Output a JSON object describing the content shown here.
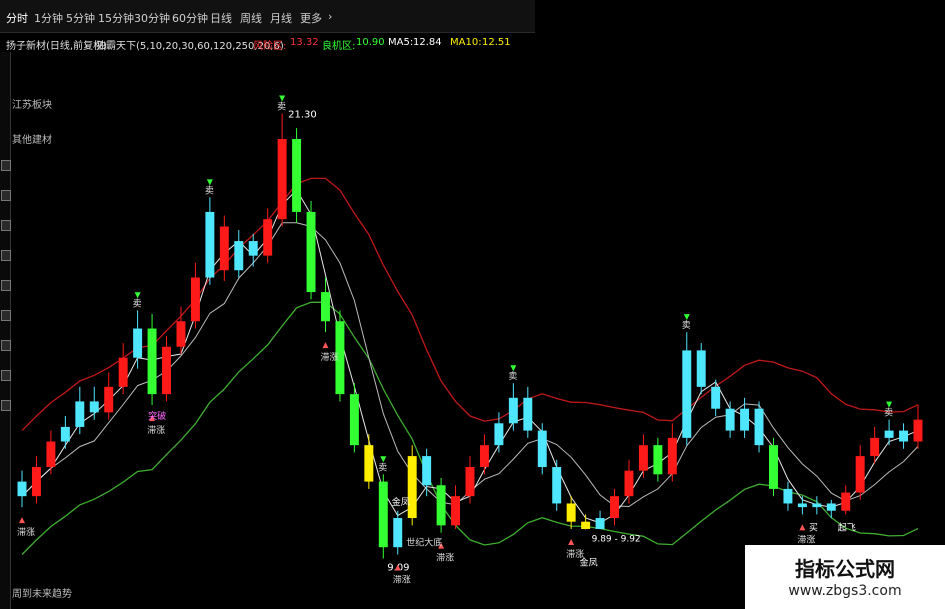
{
  "toolbar": {
    "items": [
      "分时",
      "1分钟",
      "5分钟",
      "15分钟",
      "30分钟",
      "60分钟",
      "日线",
      "周线",
      "月线",
      "更多"
    ]
  },
  "info": {
    "stock": "扬子新材(日线,前复权)",
    "indicator": "独霸天下(5,10,20,30,60,120,250,20,6)",
    "risk_label": "风险区:",
    "risk_value": "13.32",
    "opp_label": "良机区:",
    "opp_value": "10.90",
    "ma5_label": "MA5:",
    "ma5_value": "12.84",
    "ma10_label": "MA10:",
    "ma10_value": "12.51"
  },
  "side_labels": [
    "江苏板块",
    "其他建材"
  ],
  "bottom_text": "周到未来趋势",
  "colors": {
    "up": "#ff1a1a",
    "down": "#33ff33",
    "cyan": "#4fe6ff",
    "yellow": "#ffee00",
    "upper_band": "#c01818",
    "lower_band": "#3fae30",
    "ma": "#e8e8e8"
  },
  "chart_data": {
    "type": "candlestick",
    "annotations": {
      "high": "21.30",
      "low": "9.09",
      "range": "9.89 - 9.92",
      "sell": "卖",
      "buy": "买",
      "fly": "起飞",
      "gold": "金凤",
      "century": "世纪大底",
      "break": "突破",
      "tail": "滞涨"
    },
    "candles": [
      {
        "o": 11.2,
        "c": 10.8,
        "h": 11.5,
        "l": 10.5,
        "color": "cyan"
      },
      {
        "o": 10.8,
        "c": 11.6,
        "h": 11.9,
        "l": 10.6,
        "color": "up"
      },
      {
        "o": 11.6,
        "c": 12.3,
        "h": 12.6,
        "l": 11.4,
        "color": "up"
      },
      {
        "o": 12.3,
        "c": 12.7,
        "h": 13.0,
        "l": 12.1,
        "color": "cyan"
      },
      {
        "o": 12.7,
        "c": 13.4,
        "h": 13.8,
        "l": 12.5,
        "color": "cyan"
      },
      {
        "o": 13.4,
        "c": 13.1,
        "h": 13.8,
        "l": 12.9,
        "color": "cyan"
      },
      {
        "o": 13.1,
        "c": 13.8,
        "h": 14.2,
        "l": 12.9,
        "color": "up"
      },
      {
        "o": 13.8,
        "c": 14.6,
        "h": 15.0,
        "l": 13.6,
        "color": "up"
      },
      {
        "o": 14.6,
        "c": 15.4,
        "h": 15.9,
        "l": 14.3,
        "color": "cyan"
      },
      {
        "o": 15.4,
        "c": 13.6,
        "h": 15.8,
        "l": 13.3,
        "color": "down"
      },
      {
        "o": 13.6,
        "c": 14.9,
        "h": 15.2,
        "l": 13.4,
        "color": "up"
      },
      {
        "o": 14.9,
        "c": 15.6,
        "h": 16.0,
        "l": 14.7,
        "color": "up"
      },
      {
        "o": 15.6,
        "c": 16.8,
        "h": 17.2,
        "l": 15.4,
        "color": "up"
      },
      {
        "o": 16.8,
        "c": 18.6,
        "h": 19.0,
        "l": 16.6,
        "color": "cyan"
      },
      {
        "o": 18.2,
        "c": 17.0,
        "h": 18.5,
        "l": 16.7,
        "color": "red"
      },
      {
        "o": 17.0,
        "c": 17.8,
        "h": 18.1,
        "l": 16.8,
        "color": "cyan"
      },
      {
        "o": 17.8,
        "c": 17.4,
        "h": 18.0,
        "l": 17.1,
        "color": "cyan"
      },
      {
        "o": 17.4,
        "c": 18.4,
        "h": 18.7,
        "l": 17.2,
        "color": "up"
      },
      {
        "o": 18.4,
        "c": 20.6,
        "h": 21.3,
        "l": 18.2,
        "color": "up"
      },
      {
        "o": 20.6,
        "c": 18.6,
        "h": 20.9,
        "l": 18.3,
        "color": "down"
      },
      {
        "o": 18.6,
        "c": 16.4,
        "h": 18.9,
        "l": 16.2,
        "color": "down"
      },
      {
        "o": 16.4,
        "c": 15.6,
        "h": 16.8,
        "l": 15.3,
        "color": "down"
      },
      {
        "o": 15.6,
        "c": 13.6,
        "h": 15.9,
        "l": 13.4,
        "color": "down"
      },
      {
        "o": 13.6,
        "c": 12.2,
        "h": 13.9,
        "l": 12.0,
        "color": "down"
      },
      {
        "o": 12.2,
        "c": 11.2,
        "h": 12.5,
        "l": 11.0,
        "color": "yellow"
      },
      {
        "o": 11.2,
        "c": 9.4,
        "h": 11.4,
        "l": 9.09,
        "color": "down"
      },
      {
        "o": 9.4,
        "c": 10.2,
        "h": 10.4,
        "l": 9.2,
        "color": "cyan"
      },
      {
        "o": 10.2,
        "c": 11.9,
        "h": 12.2,
        "l": 10.0,
        "color": "yellow"
      },
      {
        "o": 11.9,
        "c": 11.1,
        "h": 12.1,
        "l": 10.8,
        "color": "cyan"
      },
      {
        "o": 11.1,
        "c": 10.0,
        "h": 11.3,
        "l": 9.8,
        "color": "down"
      },
      {
        "o": 10.0,
        "c": 10.8,
        "h": 11.1,
        "l": 9.9,
        "color": "up"
      },
      {
        "o": 10.8,
        "c": 11.6,
        "h": 11.9,
        "l": 10.6,
        "color": "up"
      },
      {
        "o": 11.6,
        "c": 12.2,
        "h": 12.5,
        "l": 11.4,
        "color": "up"
      },
      {
        "o": 12.2,
        "c": 12.8,
        "h": 13.1,
        "l": 12.0,
        "color": "cyan"
      },
      {
        "o": 12.8,
        "c": 13.5,
        "h": 13.9,
        "l": 12.6,
        "color": "cyan"
      },
      {
        "o": 13.5,
        "c": 12.6,
        "h": 13.8,
        "l": 12.4,
        "color": "cyan"
      },
      {
        "o": 12.6,
        "c": 11.6,
        "h": 12.8,
        "l": 11.4,
        "color": "cyan"
      },
      {
        "o": 11.6,
        "c": 10.6,
        "h": 11.8,
        "l": 10.4,
        "color": "cyan"
      },
      {
        "o": 10.6,
        "c": 10.1,
        "h": 10.8,
        "l": 9.9,
        "color": "yellow"
      },
      {
        "o": 10.1,
        "c": 9.9,
        "h": 10.3,
        "l": 9.89,
        "color": "yellow"
      },
      {
        "o": 9.9,
        "c": 10.2,
        "h": 10.4,
        "l": 9.92,
        "color": "cyan"
      },
      {
        "o": 10.2,
        "c": 10.8,
        "h": 11.0,
        "l": 10.0,
        "color": "up"
      },
      {
        "o": 10.8,
        "c": 11.5,
        "h": 11.8,
        "l": 10.6,
        "color": "up"
      },
      {
        "o": 11.5,
        "c": 12.2,
        "h": 12.5,
        "l": 11.3,
        "color": "up"
      },
      {
        "o": 12.2,
        "c": 11.4,
        "h": 12.4,
        "l": 11.2,
        "color": "down"
      },
      {
        "o": 11.4,
        "c": 12.4,
        "h": 12.8,
        "l": 11.2,
        "color": "up"
      },
      {
        "o": 12.4,
        "c": 14.8,
        "h": 15.3,
        "l": 12.2,
        "color": "cyan"
      },
      {
        "o": 14.8,
        "c": 13.8,
        "h": 15.0,
        "l": 13.6,
        "color": "cyan"
      },
      {
        "o": 13.8,
        "c": 13.2,
        "h": 14.0,
        "l": 13.0,
        "color": "cyan"
      },
      {
        "o": 13.2,
        "c": 12.6,
        "h": 13.4,
        "l": 12.4,
        "color": "cyan"
      },
      {
        "o": 12.6,
        "c": 13.2,
        "h": 13.5,
        "l": 12.4,
        "color": "cyan"
      },
      {
        "o": 13.2,
        "c": 12.2,
        "h": 13.4,
        "l": 12.0,
        "color": "cyan"
      },
      {
        "o": 12.2,
        "c": 11.0,
        "h": 12.4,
        "l": 10.8,
        "color": "down"
      },
      {
        "o": 11.0,
        "c": 10.6,
        "h": 11.2,
        "l": 10.4,
        "color": "cyan"
      },
      {
        "o": 10.6,
        "c": 10.5,
        "h": 10.8,
        "l": 10.3,
        "color": "cyan"
      },
      {
        "o": 10.5,
        "c": 10.6,
        "h": 10.8,
        "l": 10.3,
        "color": "cyan"
      },
      {
        "o": 10.6,
        "c": 10.4,
        "h": 10.7,
        "l": 10.2,
        "color": "cyan"
      },
      {
        "o": 10.4,
        "c": 10.9,
        "h": 11.1,
        "l": 10.3,
        "color": "up"
      },
      {
        "o": 10.9,
        "c": 11.9,
        "h": 12.2,
        "l": 10.7,
        "color": "up"
      },
      {
        "o": 11.9,
        "c": 12.4,
        "h": 12.7,
        "l": 11.7,
        "color": "up"
      },
      {
        "o": 12.4,
        "c": 12.6,
        "h": 12.9,
        "l": 12.2,
        "color": "cyan"
      },
      {
        "o": 12.6,
        "c": 12.3,
        "h": 12.8,
        "l": 12.1,
        "color": "cyan"
      },
      {
        "o": 12.3,
        "c": 12.9,
        "h": 13.3,
        "l": 12.1,
        "color": "up"
      }
    ]
  }
}
